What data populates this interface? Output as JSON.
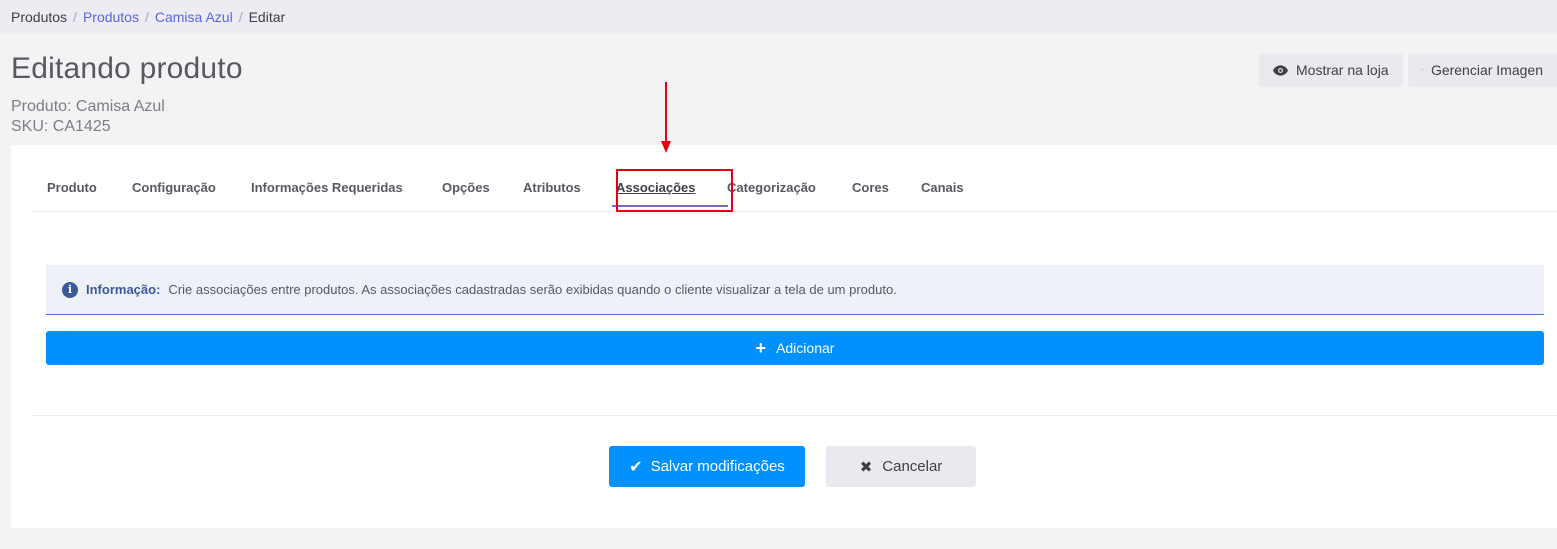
{
  "breadcrumb": {
    "items": [
      {
        "label": "Produtos"
      },
      {
        "label": "Produtos"
      },
      {
        "label": "Camisa Azul"
      },
      {
        "label": "Editar"
      }
    ],
    "separator": "/"
  },
  "header": {
    "title": "Editando produto",
    "product_line": "Produto: Camisa Azul",
    "sku_line": "SKU: CA1425"
  },
  "actions": {
    "show_store": {
      "label": "Mostrar na loja",
      "icon": "eye-icon"
    },
    "manage_images": {
      "label": "Gerenciar Imagen",
      "icon": "image-icon"
    }
  },
  "tabs": [
    {
      "label": "Produto"
    },
    {
      "label": "Configuração"
    },
    {
      "label": "Informações Requeridas"
    },
    {
      "label": "Opções"
    },
    {
      "label": "Atributos"
    },
    {
      "label": "Associações",
      "active": true
    },
    {
      "label": "Categorização"
    },
    {
      "label": "Cores"
    },
    {
      "label": "Canais"
    }
  ],
  "info": {
    "title": "Informação:",
    "text": "Crie associações entre produtos. As associações cadastradas serão exibidas quando o cliente visualizar a tela de um produto.",
    "icon_glyph": "i"
  },
  "add_button": {
    "label": "Adicionar",
    "icon_glyph": "+"
  },
  "footer": {
    "save_label": "Salvar modificações",
    "save_glyph": "✔",
    "cancel_label": "Cancelar",
    "cancel_glyph": "✖"
  },
  "colors": {
    "primary": "#0091ff",
    "highlight": "#e3000f",
    "info_accent": "#3b5998"
  }
}
